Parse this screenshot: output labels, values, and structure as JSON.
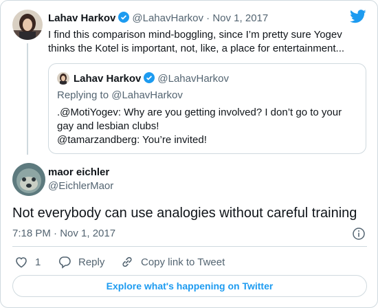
{
  "accent_color": "#1d9bf0",
  "text_color": "#0f1419",
  "muted_color": "#536471",
  "tweet1": {
    "name": "Lahav Harkov",
    "handle": "@LahavHarkov",
    "separator": " · ",
    "date": "Nov 1, 2017",
    "text": "I find this comparison mind-boggling, since I’m pretty sure Yogev thinks the Kotel is important, not, like, a place for entertainment...",
    "quoted": {
      "name": "Lahav Harkov",
      "handle": "@LahavHarkov",
      "replying_to": "Replying to @LahavHarkov",
      "line1": ".@MotiYogev: Why are you getting involved? I don’t go to your gay and lesbian clubs!",
      "line2": "@tamarzandberg: You’re invited!"
    }
  },
  "tweet2": {
    "name": "maor eichler",
    "handle": "@EichlerMaor",
    "text": "Not everybody can use analogies without careful training",
    "timestamp": "7:18 PM · Nov 1, 2017"
  },
  "actions": {
    "like_count": "1",
    "reply_label": "Reply",
    "copy_label": "Copy link to Tweet"
  },
  "explore_label": "Explore what's happening on Twitter",
  "icons": [
    "twitter-bird-icon",
    "verified-badge-icon",
    "info-icon",
    "heart-icon",
    "reply-bubble-icon",
    "link-icon"
  ]
}
